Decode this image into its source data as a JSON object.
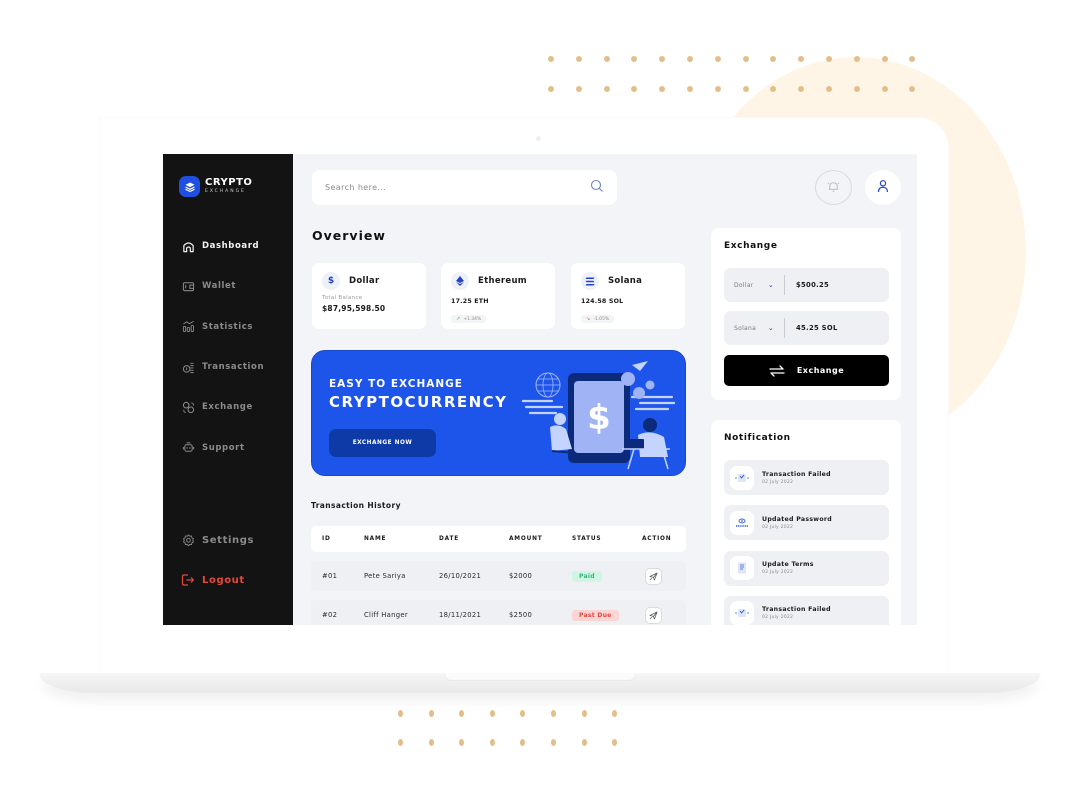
{
  "brand": {
    "title": "CRYPTO",
    "subtitle": "EXCHANGE"
  },
  "sidebar": {
    "items": [
      {
        "label": "Dashboard",
        "icon": "home-icon",
        "active": true
      },
      {
        "label": "Wallet",
        "icon": "wallet-icon",
        "active": false
      },
      {
        "label": "Statistics",
        "icon": "statistics-icon",
        "active": false
      },
      {
        "label": "Transaction",
        "icon": "coins-icon",
        "active": false
      },
      {
        "label": "Exchange",
        "icon": "exchange-icon",
        "active": false
      },
      {
        "label": "Support",
        "icon": "support-icon",
        "active": false
      }
    ],
    "bottom": [
      {
        "label": "Settings",
        "icon": "gear-icon"
      },
      {
        "label": "Logout",
        "icon": "logout-icon"
      }
    ]
  },
  "search": {
    "placeholder": "Search here..."
  },
  "overview": {
    "title": "Overview",
    "cards": [
      {
        "name": "Dollar",
        "icon": "dollar-icon",
        "label": "Total Balance",
        "value": "$87,95,598.50"
      },
      {
        "name": "Ethereum",
        "icon": "ethereum-icon",
        "amount": "17.25 ETH",
        "change": "+1.34%",
        "direction": "up"
      },
      {
        "name": "Solana",
        "icon": "solana-icon",
        "amount": "124.58 SOL",
        "change": "-1.05%",
        "direction": "down"
      }
    ]
  },
  "banner": {
    "line1": "EASY TO EXCHANGE",
    "line2": "CRYPTOCURRENCY",
    "button": "EXCHANGE NOW"
  },
  "transactions": {
    "title": "Transaction History",
    "columns": [
      "ID",
      "NAME",
      "DATE",
      "AMOUNT",
      "STATUS",
      "ACTION"
    ],
    "rows": [
      {
        "id": "#01",
        "name": "Pete Sariya",
        "date": "26/10/2021",
        "amount": "$2000",
        "status": "Paid"
      },
      {
        "id": "#02",
        "name": "Cliff Hanger",
        "date": "18/11/2021",
        "amount": "$2500",
        "status": "Past Due"
      }
    ]
  },
  "exchange": {
    "title": "Exchange",
    "from": {
      "currency": "Dollar",
      "value": "$500.25"
    },
    "to": {
      "currency": "Solana",
      "value": "45.25 SOL"
    },
    "button": "Exchange"
  },
  "notifications": {
    "title": "Notification",
    "items": [
      {
        "title": "Transaction Failed",
        "date": "02 July 2022"
      },
      {
        "title": "Updated Password",
        "date": "02 July 2022"
      },
      {
        "title": "Update Terms",
        "date": "02 July 2022"
      },
      {
        "title": "Transaction Failed",
        "date": "02 July 2022"
      }
    ]
  },
  "colors": {
    "accent": "#1d55ea",
    "sidebar": "#131313",
    "logout": "#e5473c",
    "paid": "#2fb876",
    "past_due": "#e5473c",
    "decoration": "#e2bf8a"
  }
}
